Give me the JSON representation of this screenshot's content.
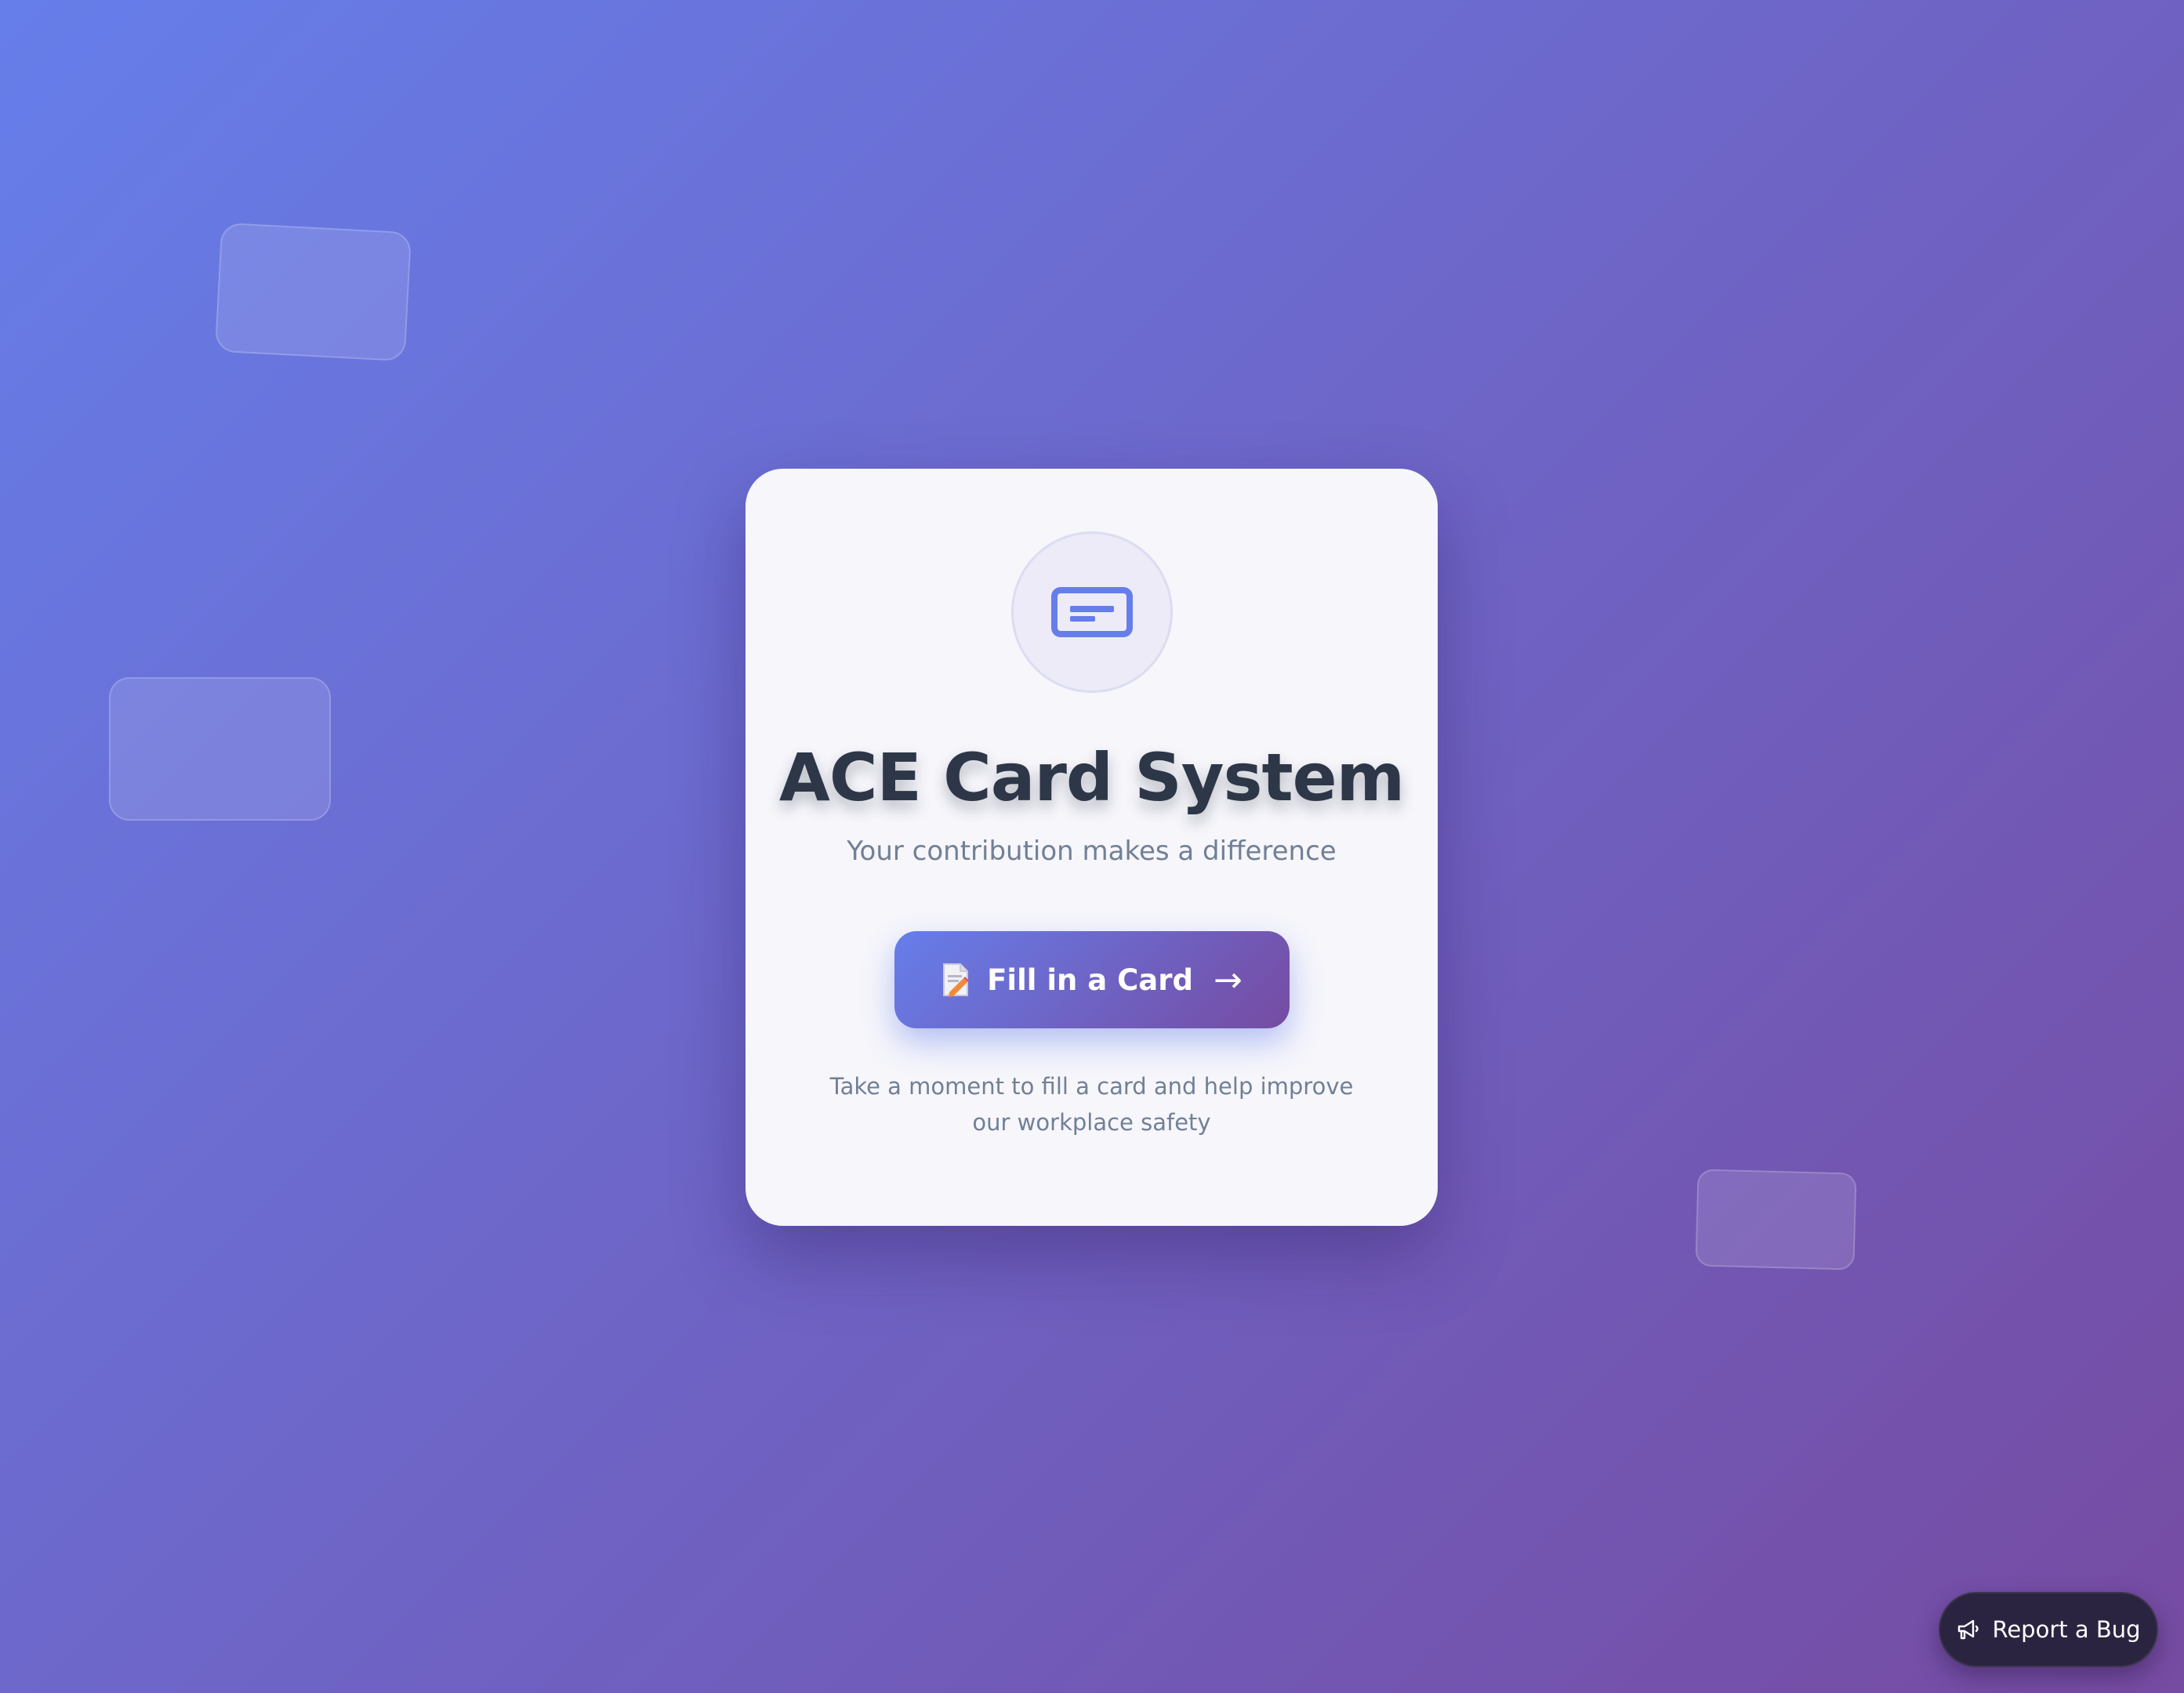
{
  "header": {
    "title": "ACE Card System",
    "subtitle": "Your contribution makes a difference"
  },
  "cta": {
    "label": "Fill in a Card",
    "arrow": "→",
    "icon": "document-pencil-icon"
  },
  "helper_text": "Take a moment to fill a card and help improve our workplace safety",
  "bug_report": {
    "label": "Report a Bug",
    "icon": "megaphone-icon"
  },
  "theme": {
    "gradient_start": "#667eea",
    "gradient_end": "#764ba2",
    "title_color": "#2d3748",
    "muted_text": "#718096",
    "card_background": "#f6f6fb",
    "bug_button_background": "#2b2440"
  }
}
